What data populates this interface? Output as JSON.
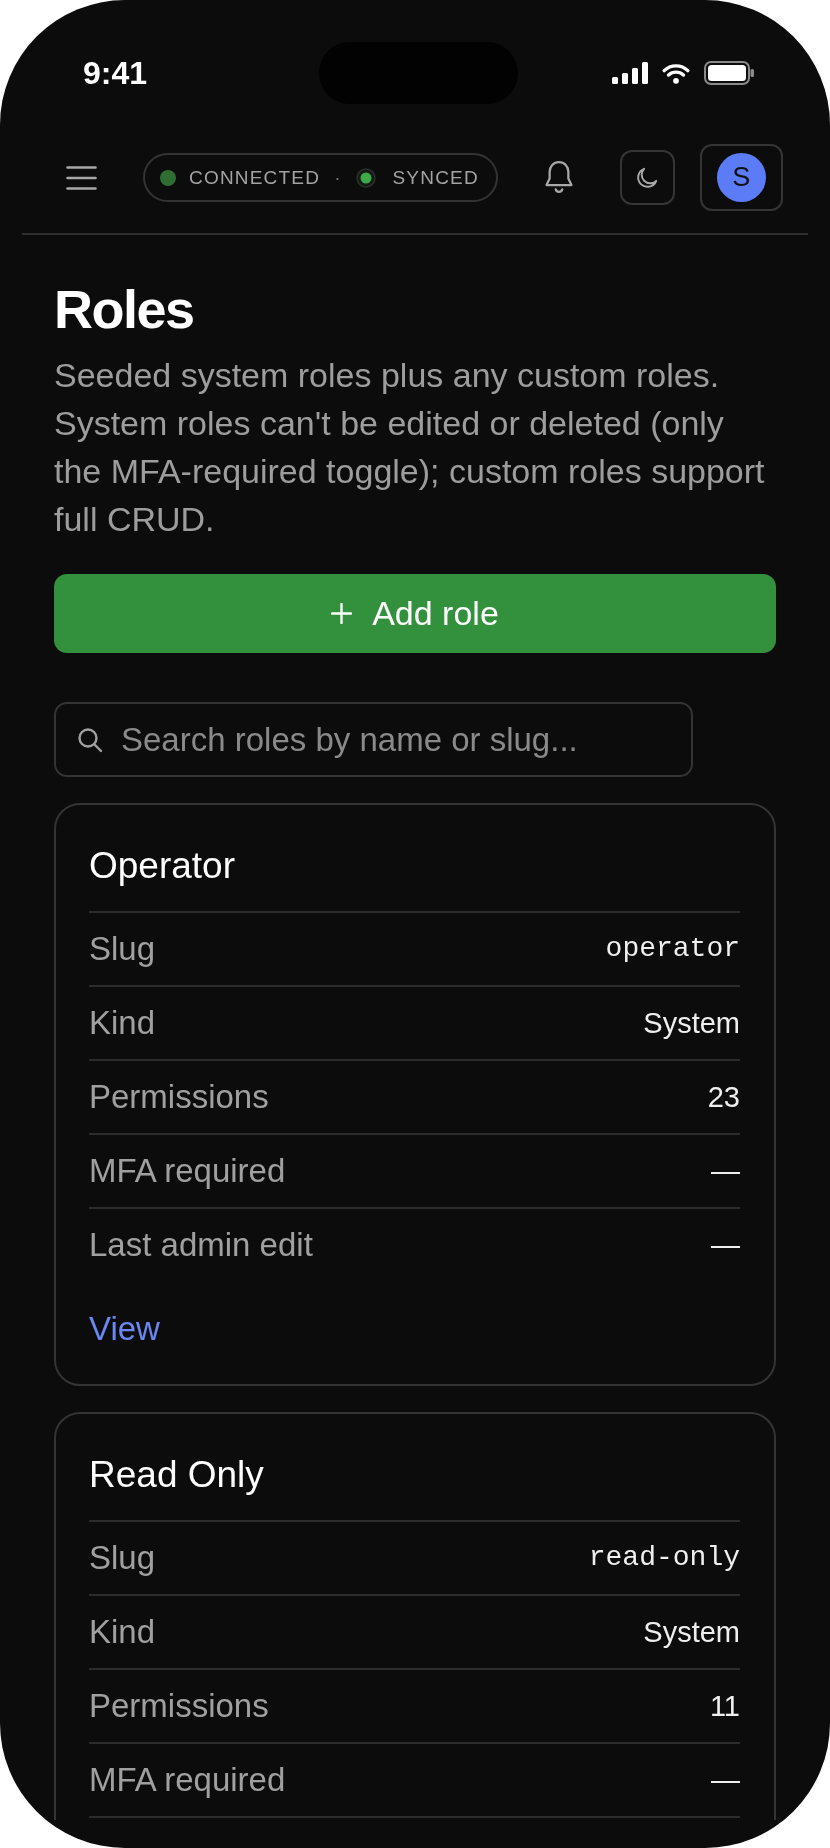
{
  "status_bar": {
    "time": "9:41"
  },
  "header": {
    "connection": [
      {
        "label": "CONNECTED",
        "color": "#2e6e31",
        "kind": "plain"
      },
      {
        "label": "SYNCED",
        "color": "#3daa47",
        "kind": "ringed"
      }
    ],
    "separator": "·",
    "profile": {
      "initial": "S",
      "color": "#5b7cf6"
    }
  },
  "page": {
    "title": "Roles",
    "description": "Seeded system roles plus any custom roles. System roles can't be edited or deleted (only the MFA-required toggle); custom roles support full CRUD.",
    "add_button": "Add role",
    "search": {
      "placeholder": "Search roles by name or slug..."
    }
  },
  "roles": [
    {
      "title": "Operator",
      "fields": [
        {
          "label": "Slug",
          "value": "operator",
          "kind": "code"
        },
        {
          "label": "Kind",
          "value": "System",
          "kind": "text"
        },
        {
          "label": "Permissions",
          "value": "23",
          "kind": "text"
        },
        {
          "label": "MFA required",
          "value": "—",
          "kind": "text"
        },
        {
          "label": "Last admin edit",
          "value": "—",
          "kind": "text"
        }
      ],
      "link": "View"
    },
    {
      "title": "Read Only",
      "fields": [
        {
          "label": "Slug",
          "value": "read-only",
          "kind": "code"
        },
        {
          "label": "Kind",
          "value": "System",
          "kind": "text"
        },
        {
          "label": "Permissions",
          "value": "11",
          "kind": "text"
        },
        {
          "label": "MFA required",
          "value": "—",
          "kind": "text"
        }
      ]
    }
  ]
}
